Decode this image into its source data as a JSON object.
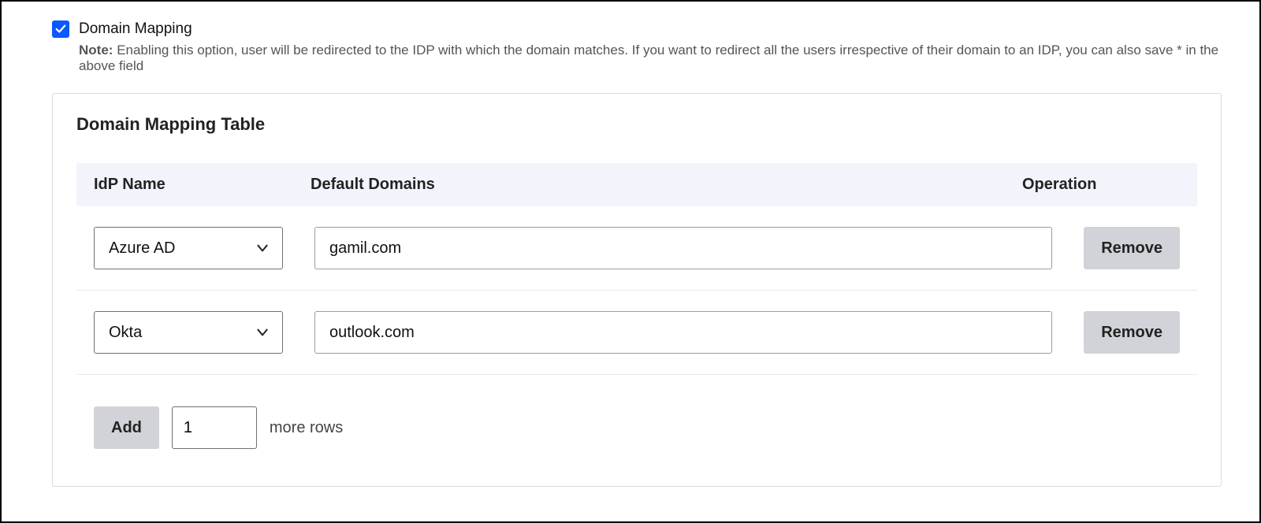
{
  "header": {
    "checkbox_checked": true,
    "feature_label": "Domain Mapping",
    "note_bold": "Note:",
    "note_text": "Enabling this option, user will be redirected to the IDP with which the domain matches. If you want to redirect all the users irrespective of their domain to an IDP, you can also save * in the above field"
  },
  "panel": {
    "title": "Domain Mapping Table",
    "columns": {
      "idp_name": "IdP Name",
      "default_domains": "Default Domains",
      "operation": "Operation"
    }
  },
  "rows": [
    {
      "idp": "Azure AD",
      "domain": "gamil.com",
      "remove_label": "Remove"
    },
    {
      "idp": "Okta",
      "domain": "outlook.com",
      "remove_label": "Remove"
    }
  ],
  "add_section": {
    "add_label": "Add",
    "count_value": "1",
    "more_rows_label": "more rows"
  }
}
